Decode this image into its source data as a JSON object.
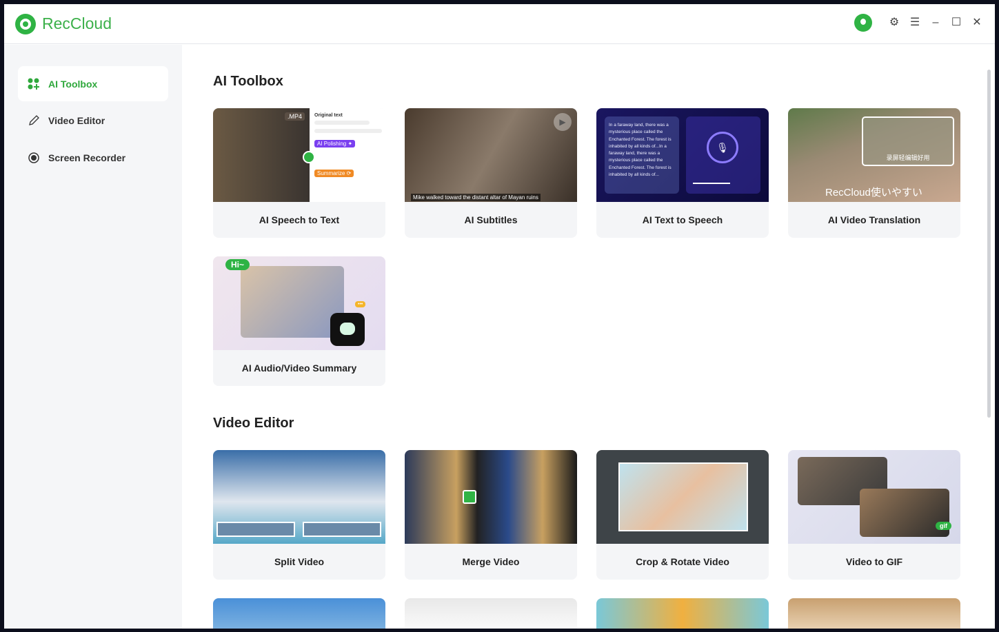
{
  "app": {
    "name": "RecCloud"
  },
  "header": {
    "icons": [
      "avatar",
      "gear-icon",
      "menu-icon",
      "minimize-icon",
      "maximize-icon",
      "close-icon"
    ]
  },
  "sidebar": {
    "items": [
      {
        "label": "AI Toolbox",
        "icon": "grid-icon",
        "active": true
      },
      {
        "label": "Video Editor",
        "icon": "pencil-icon"
      },
      {
        "label": "Screen Recorder",
        "icon": "record-icon"
      }
    ]
  },
  "sections": [
    {
      "title": "AI Toolbox",
      "cards": [
        {
          "label": "AI Speech to Text",
          "overlay": {
            "format": ".MP4",
            "original": "Original text",
            "polish": "AI Polishing ✦",
            "summarize": "Summarize ⟳"
          }
        },
        {
          "label": "AI Subtitles",
          "overlay": {
            "subtitle": "Mike walked toward the distant altar of Mayan ruins"
          }
        },
        {
          "label": "AI Text to Speech",
          "overlay": {
            "text": "In a faraway land, there was a mysterious place called the Enchanted Forest. The forest is inhabited by all kinds of...In a faraway land, there was a mysterious place called the Enchanted Forest. The forest is inhabited by all kinds of..."
          }
        },
        {
          "label": "AI Video Translation",
          "overlay": {
            "inner": "录屏轻编辑好用",
            "caption": "RecCloud使いやすい"
          }
        },
        {
          "label": "AI Audio/Video Summary",
          "overlay": {
            "bubble": "Hi~",
            "dots": "•••"
          }
        }
      ]
    },
    {
      "title": "Video Editor",
      "cards": [
        {
          "label": "Split Video"
        },
        {
          "label": "Merge Video"
        },
        {
          "label": "Crop & Rotate Video"
        },
        {
          "label": "Video to GIF",
          "overlay": {
            "badge": "gif"
          }
        }
      ]
    }
  ],
  "colors": {
    "accent": "#2fa83c",
    "sidebar": "#f5f6f8"
  }
}
